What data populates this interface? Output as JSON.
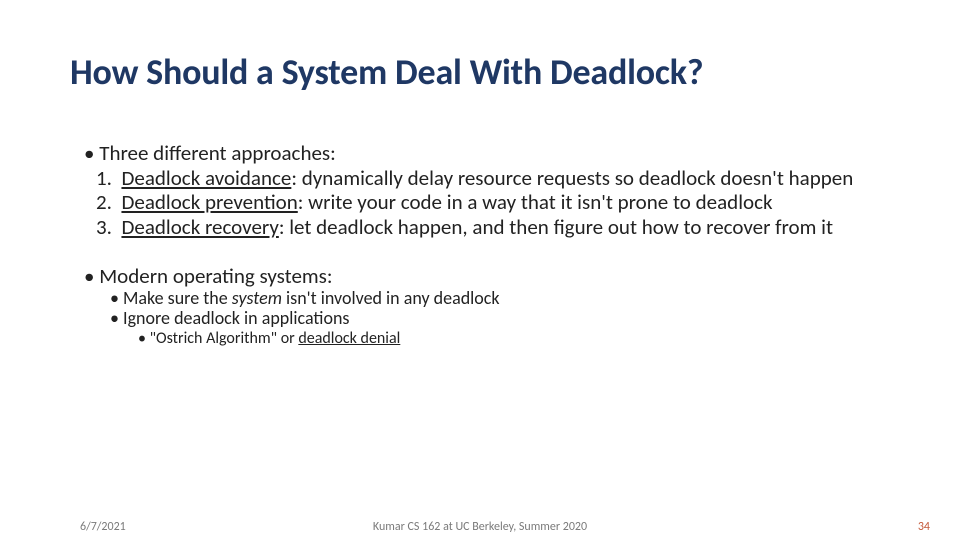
{
  "title": "How Should a System Deal With Deadlock?",
  "intro": "Three different approaches:",
  "items": [
    {
      "num": "1.",
      "term": "Deadlock avoidance",
      "rest": ": dynamically delay resource requests so deadlock doesn't happen"
    },
    {
      "num": "2.",
      "term": "Deadlock prevention",
      "rest": ": write your code in a way that it isn't prone to deadlock"
    },
    {
      "num": "3.",
      "term": "Deadlock recovery",
      "rest": ": let deadlock happen, and then figure out how to recover from it"
    }
  ],
  "modern": "Modern operating systems:",
  "sub": [
    {
      "pre": "Make sure the ",
      "em": "system",
      "post": " isn't involved in any deadlock"
    },
    {
      "pre": "Ignore deadlock in applications",
      "em": "",
      "post": ""
    }
  ],
  "ostrich": {
    "pre": "\"Ostrich Algorithm\" or ",
    "u": "deadlock denial"
  },
  "footer": {
    "date": "6/7/2021",
    "center": "Kumar CS 162 at UC Berkeley, Summer 2020",
    "num": "34"
  }
}
